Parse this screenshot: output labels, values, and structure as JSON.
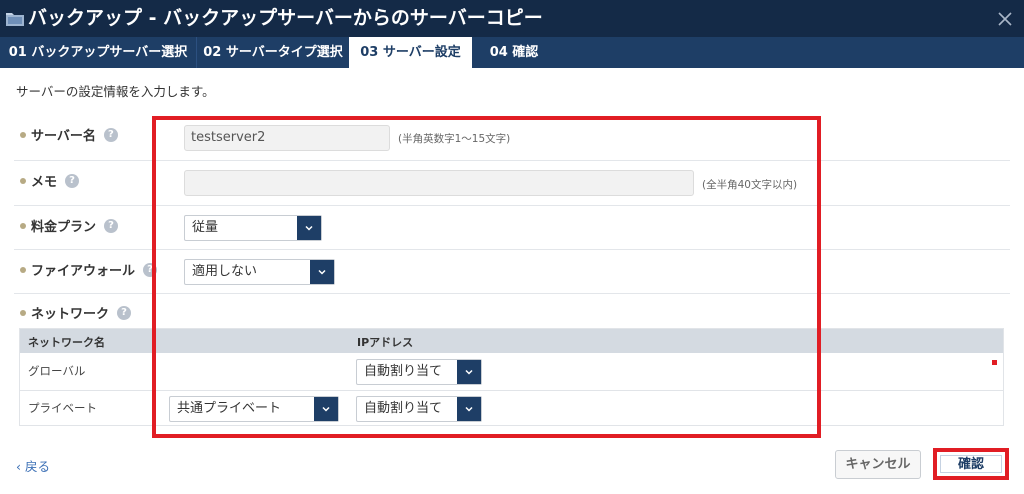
{
  "window": {
    "title": "バックアップ - バックアップサーバーからのサーバーコピー",
    "icon": "folder-icon",
    "close_icon": "close-icon"
  },
  "tabs": [
    {
      "label": "01 バックアップサーバー選択",
      "active": false
    },
    {
      "label": "02 サーバータイプ選択",
      "active": false
    },
    {
      "label": "03 サーバー設定",
      "active": true
    },
    {
      "label": "04 確認",
      "active": false
    }
  ],
  "intro": "サーバーの設定情報を入力します。",
  "form": {
    "server_name": {
      "label": "サーバー名",
      "value": "testserver2",
      "hint": "(半角英数字1～15文字)"
    },
    "memo": {
      "label": "メモ",
      "value": "",
      "hint": "(全半角40文字以内)"
    },
    "plan": {
      "label": "料金プラン",
      "selected": "従量"
    },
    "firewall": {
      "label": "ファイアウォール",
      "selected": "適用しない"
    },
    "network": {
      "label": "ネットワーク"
    }
  },
  "help_icon_glyph": "?",
  "network_table": {
    "headers": [
      "ネットワーク名",
      "IPアドレス"
    ],
    "rows": [
      {
        "name": "グローバル",
        "network_select": null,
        "ip_select": "自動割り当て"
      },
      {
        "name": "プライベート",
        "network_select": "共通プライベート",
        "ip_select": "自動割り当て"
      }
    ]
  },
  "footer": {
    "back_label": "戻る",
    "cancel_label": "キャンセル",
    "confirm_label": "確認"
  },
  "colors": {
    "titlebar": "#142a47",
    "tab_bg": "#1e3e66",
    "highlight": "#e11d24",
    "link": "#3b6fb5"
  }
}
